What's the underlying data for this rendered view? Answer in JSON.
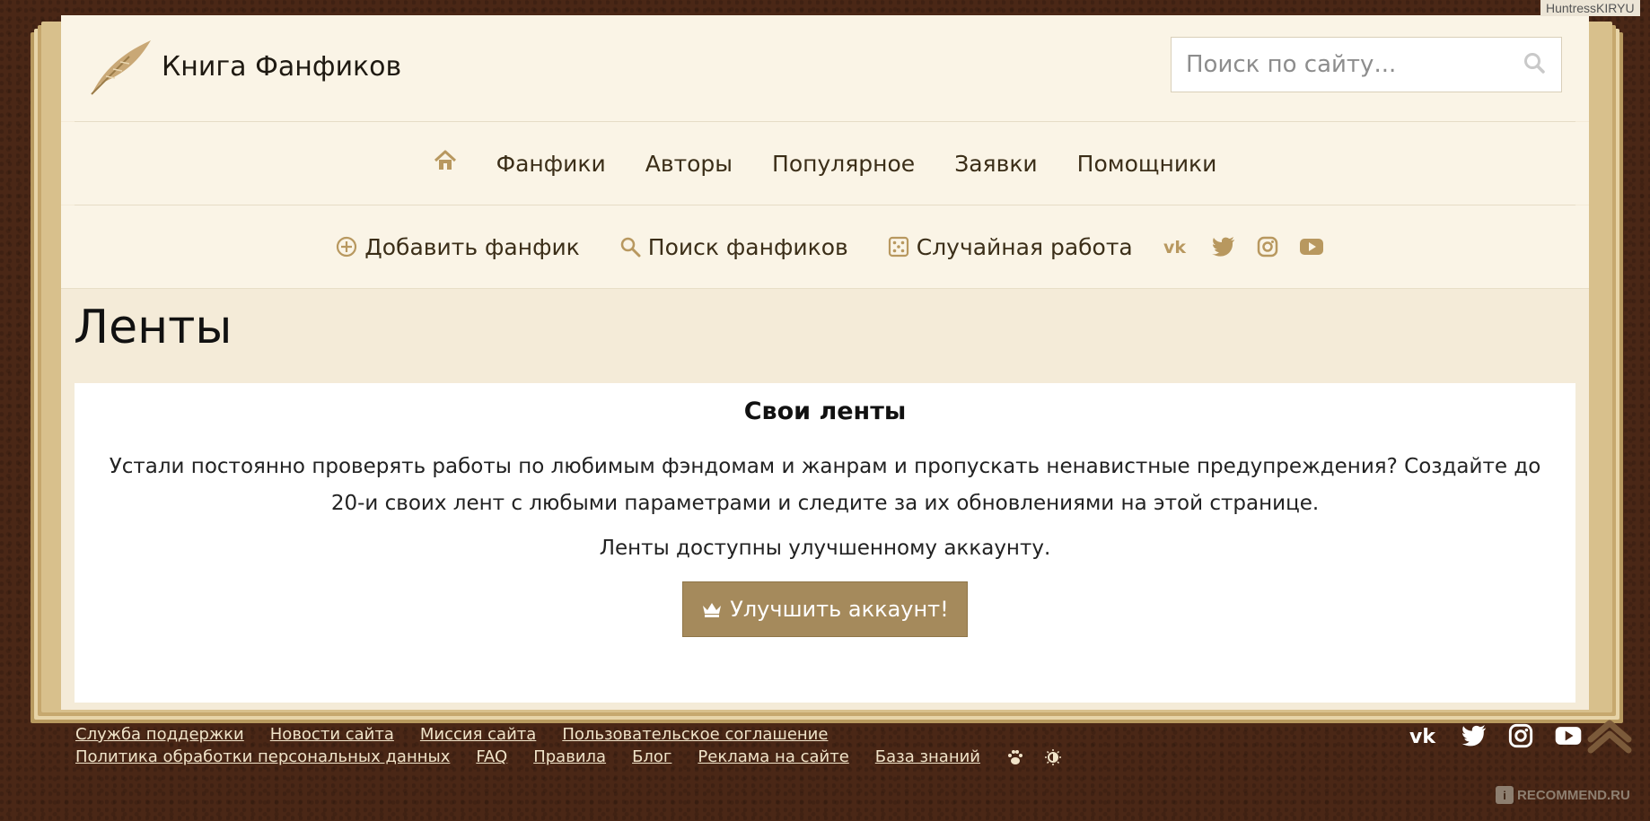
{
  "site": {
    "name": "Книга Фанфиков"
  },
  "search": {
    "placeholder": "Поиск по сайту..."
  },
  "nav_main": {
    "home_icon": "home-icon",
    "items": [
      "Фанфики",
      "Авторы",
      "Популярное",
      "Заявки",
      "Помощники"
    ]
  },
  "nav_sub": {
    "add_fanfic": "Добавить фанфик",
    "search_fanfics": "Поиск фанфиков",
    "random_work": "Случайная работа",
    "social": [
      "vk-icon",
      "twitter-icon",
      "instagram-icon",
      "youtube-icon"
    ]
  },
  "page": {
    "title": "Ленты"
  },
  "card": {
    "title": "Свои ленты",
    "text": "Устали постоянно проверять работы по любимым фэндомам и жанрам и пропускать ненавистные предупреждения? Создайте до 20-и своих лент с любыми параметрами и следите за их обновлениями на этой странице.",
    "note": "Ленты доступны улучшенному аккаунту.",
    "button": "Улучшить аккаунт!"
  },
  "footer": {
    "row1": [
      "Служба поддержки",
      "Новости сайта",
      "Миссия сайта",
      "Пользовательское соглашение"
    ],
    "row2": [
      "Политика обработки персональных данных",
      "FAQ",
      "Правила",
      "Блог",
      "Реклама на сайте",
      "База знаний"
    ],
    "icons": [
      "paw-icon",
      "theme-toggle-icon"
    ],
    "social": [
      "vk-icon",
      "twitter-icon",
      "instagram-icon",
      "youtube-icon"
    ]
  },
  "watermarks": {
    "top": "HuntressKIRYU",
    "bottom": "RECOMMEND.RU",
    "bottom_mark": "i"
  },
  "colors": {
    "accent": "#a58a5c",
    "icon": "#b8985f",
    "background": "#4a2716",
    "paper": "#faf4e6"
  }
}
